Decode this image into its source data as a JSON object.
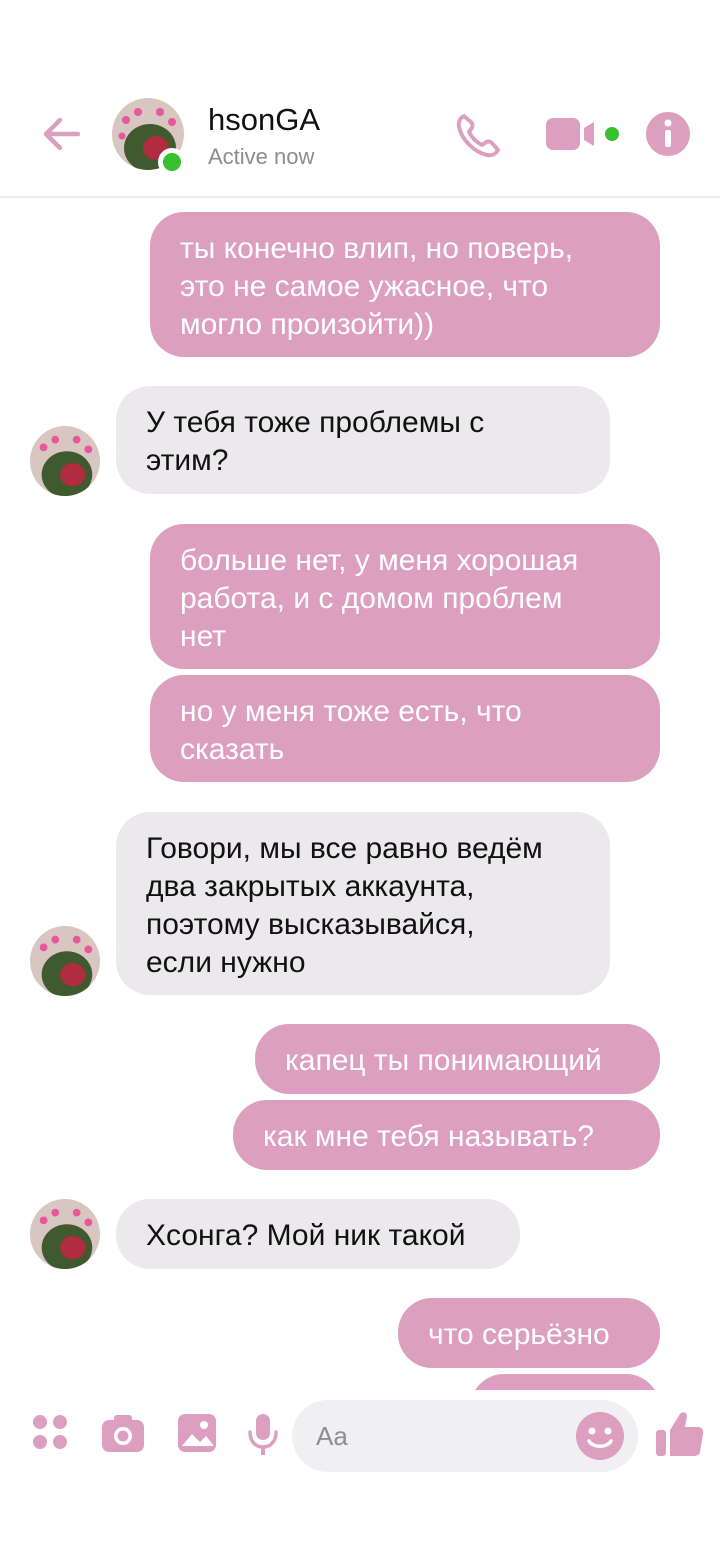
{
  "header": {
    "contact_name": "hsonGA",
    "status": "Active now"
  },
  "icons": {
    "back": "back-arrow-icon",
    "call": "phone-icon",
    "video": "video-camera-icon",
    "info": "info-icon",
    "apps": "apps-grid-icon",
    "camera": "camera-icon",
    "gallery": "image-icon",
    "mic": "microphone-icon",
    "emoji": "emoji-icon",
    "like": "thumbs-up-icon"
  },
  "colors": {
    "accent": "#dd9fc0",
    "incoming_bubble": "#ebe9ec",
    "online": "#37c02f"
  },
  "messages": [
    {
      "side": "out",
      "text": "ты конечно влип, но поверь,\nэто не самое ужасное, что\nмогло произойти))"
    },
    {
      "side": "in",
      "text": "У тебя тоже проблемы с\nэтим?"
    },
    {
      "side": "out",
      "text": "больше нет, у меня хорошая\nработа, и с домом проблем\nнет"
    },
    {
      "side": "out",
      "text": "но у меня тоже есть, что\nсказать"
    },
    {
      "side": "in",
      "text": "Говори, мы все равно ведём\nдва закрытых аккаунта,\nпоэтому высказывайся,\nесли нужно"
    },
    {
      "side": "out",
      "text": "капец ты понимающий"
    },
    {
      "side": "out",
      "text": "как мне тебя называть?"
    },
    {
      "side": "in",
      "text": "Хсонга? Мой ник такой"
    },
    {
      "side": "out",
      "text": "что серьёзно"
    }
  ],
  "composer": {
    "placeholder": "Aa"
  }
}
